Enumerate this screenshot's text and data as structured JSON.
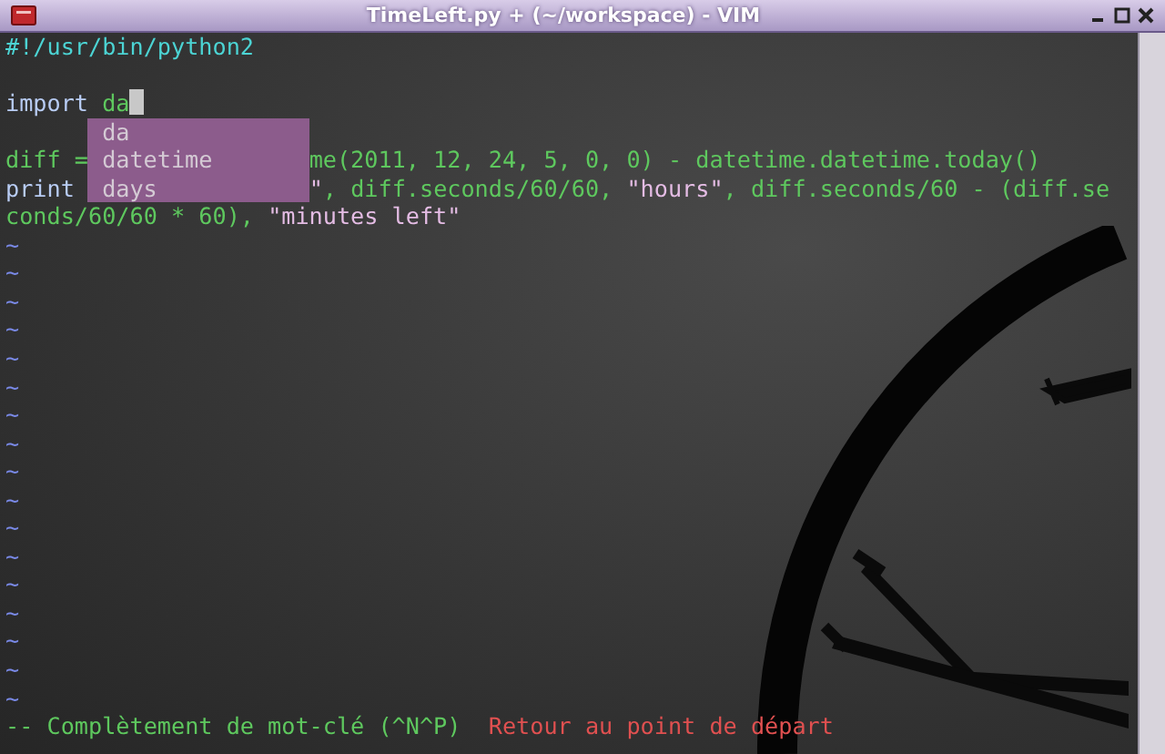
{
  "window": {
    "title": "TimeLeft.py + (~/workspace) - VIM"
  },
  "buffer": {
    "lines": [
      {
        "kind": "code",
        "segments": [
          {
            "kind": "comment",
            "text": "#!/usr/bin/python2"
          }
        ]
      },
      {
        "kind": "blank"
      },
      {
        "kind": "code",
        "cursor": true,
        "segments": [
          {
            "kind": "keyword",
            "text": "import"
          },
          {
            "kind": "plain",
            "text": " da"
          }
        ]
      },
      {
        "kind": "blank"
      },
      {
        "kind": "code",
        "segments": [
          {
            "kind": "plain",
            "text": "diff ="
          },
          {
            "kind": "plain",
            "after_menu": true,
            "text": "me(2011, 12, 24, 5, 0, 0) - datetime.datetime.today()"
          }
        ]
      },
      {
        "kind": "code",
        "segments": [
          {
            "kind": "keyword",
            "text": "print"
          },
          {
            "kind": "string",
            "after_menu": true,
            "text": "\""
          },
          {
            "kind": "plain",
            "text": ", diff.seconds/60/60, "
          },
          {
            "kind": "string",
            "text": "\"hours\""
          },
          {
            "kind": "plain",
            "text": ", diff.seconds/60 - (diff.se"
          }
        ]
      },
      {
        "kind": "code",
        "segments": [
          {
            "kind": "plain",
            "text": "conds/60/60 * 60), "
          },
          {
            "kind": "string",
            "text": "\"minutes left\""
          }
        ]
      },
      {
        "kind": "tilde",
        "text": "~"
      },
      {
        "kind": "tilde",
        "text": "~"
      },
      {
        "kind": "tilde",
        "text": "~"
      },
      {
        "kind": "tilde",
        "text": "~"
      },
      {
        "kind": "tilde",
        "text": "~"
      },
      {
        "kind": "tilde",
        "text": "~"
      },
      {
        "kind": "tilde",
        "text": "~"
      },
      {
        "kind": "tilde",
        "text": "~"
      },
      {
        "kind": "tilde",
        "text": "~"
      },
      {
        "kind": "tilde",
        "text": "~"
      },
      {
        "kind": "tilde",
        "text": "~"
      },
      {
        "kind": "tilde",
        "text": "~"
      },
      {
        "kind": "tilde",
        "text": "~"
      },
      {
        "kind": "tilde",
        "text": "~"
      },
      {
        "kind": "tilde",
        "text": "~"
      },
      {
        "kind": "tilde",
        "text": "~"
      },
      {
        "kind": "tilde",
        "text": "~"
      }
    ]
  },
  "completion_menu": {
    "items": [
      {
        "text": "da",
        "selected": false
      },
      {
        "text": "datetime",
        "selected": false
      },
      {
        "text": "days",
        "selected": false
      }
    ]
  },
  "status_line": {
    "mode": "-- Complètement de mot-clé (^N^P)",
    "message": "Retour au point de départ"
  }
}
